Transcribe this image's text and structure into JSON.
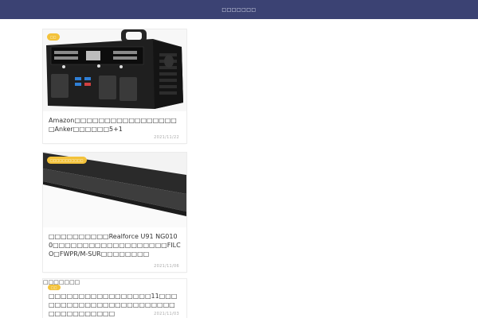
{
  "header": {
    "title": "□□□□□□□"
  },
  "cards": [
    {
      "badge": "□□",
      "title": "Amazon□□□□□□□□□□□□□□□□□□Anker□□□□□□5+1",
      "date": "2021/11/22"
    },
    {
      "badge": "□□□□□□□□□□□",
      "title": "□□□□□□□□□□Realforce U91 NG0100□□□□□□□□□□□□□□□□□□□FILCO□FWPR/M-SUR□□□□□□□□",
      "date": "2021/11/06"
    },
    {
      "label": "□□□□□□□",
      "badge": "□□",
      "title": "□□□□□□□□□□□□□□□□□11□□□□□□□□□□□□□□□□□□□□□□□□□□□□□□□□□□□",
      "date": "2021/11/03"
    }
  ],
  "colors": {
    "header_bg": "#3b4273",
    "badge": "#f3c23a"
  }
}
